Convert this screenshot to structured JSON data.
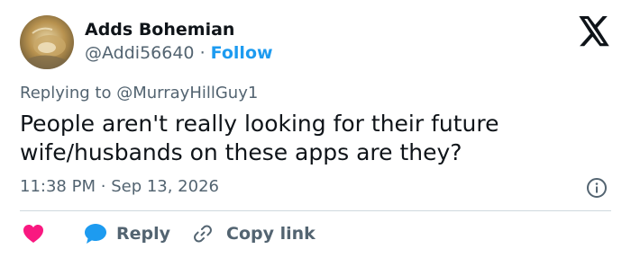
{
  "author": {
    "display_name": "Adds Bohemian",
    "handle": "@Addi56640",
    "separator": "·",
    "follow_label": "Follow"
  },
  "reply_context": {
    "prefix": "Replying to",
    "mention": "@MurrayHillGuy1"
  },
  "tweet": {
    "text": "People aren't really looking for their future wife/husbands on these apps are they?",
    "time": "11:38 PM",
    "separator": "·",
    "date": "Sep 13, 2026"
  },
  "actions": {
    "reply_label": "Reply",
    "copy_link_label": "Copy link"
  },
  "icons": {
    "avatar": "avatar-photo",
    "brand": "x-logo-icon",
    "info": "info-icon",
    "like": "heart-icon",
    "reply": "speech-bubble-icon",
    "copy": "link-icon"
  },
  "colors": {
    "accent": "#1d9bf0",
    "heart": "#f91880",
    "muted_text": "#536471",
    "primary_text": "#0f1419",
    "divider": "#cfd9de"
  }
}
